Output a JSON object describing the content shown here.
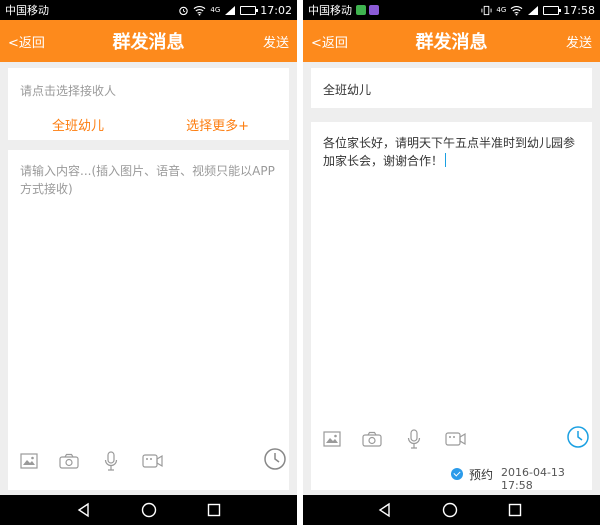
{
  "left": {
    "status": {
      "carrier": "中国移动",
      "time": "17:02",
      "network": "4G",
      "battery_level": 0.8
    },
    "header": {
      "back": "<返回",
      "title": "群发消息",
      "send": "发送"
    },
    "recipients": {
      "placeholder": "请点击选择接收人",
      "quick_select": "全班幼儿",
      "more": "选择更多+"
    },
    "message": {
      "placeholder": "请输入内容...(插入图片、语音、视频只能以APP方式接收)"
    },
    "toolbar": {
      "icons": [
        "image-icon",
        "camera-icon",
        "microphone-icon",
        "video-icon",
        "clock-icon"
      ]
    }
  },
  "right": {
    "status": {
      "carrier": "中国移动",
      "time": "17:58",
      "network": "4G",
      "battery_level": 0.75,
      "app_badges": [
        "wechat-icon",
        "app-icon"
      ]
    },
    "header": {
      "back": "<返回",
      "title": "群发消息",
      "send": "发送"
    },
    "recipients": {
      "value": "全班幼儿"
    },
    "message": {
      "text": "各位家长好，请明天下午五点半准时到幼儿园参加家长会，谢谢合作！"
    },
    "toolbar": {
      "icons": [
        "image-icon",
        "camera-icon",
        "microphone-icon",
        "video-icon",
        "clock-icon"
      ]
    },
    "schedule": {
      "label": "预约",
      "datetime": "2016-04-13 17:58",
      "checked": true
    }
  },
  "colors": {
    "accent": "#fd8a1c",
    "link": "#fd7d0f",
    "active_blue": "#1ba0e2"
  }
}
